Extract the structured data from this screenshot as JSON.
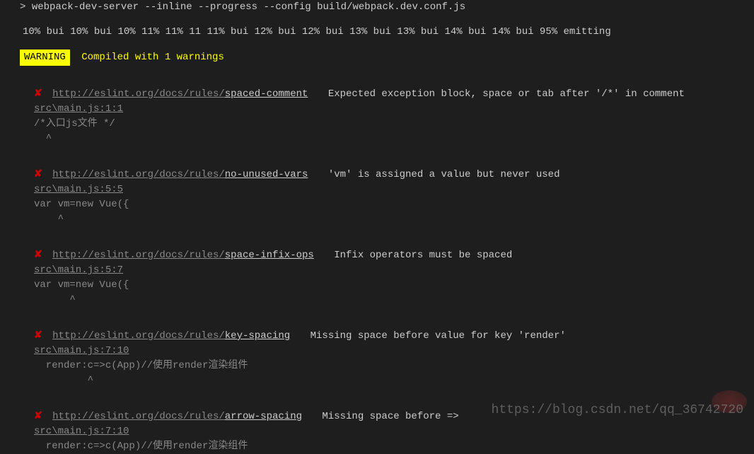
{
  "cmd": {
    "prompt": ">",
    "command": "webpack-dev-server --inline --progress --config build/webpack.dev.conf.js"
  },
  "progress": "10% bui 10% bui 10% 11% 11% 11 11% bui 12% bui 12% bui 13% bui 13% bui 14% bui 14% bui 95% emitting",
  "warning": {
    "badge": "WARNING",
    "text": "Compiled with 1 warnings"
  },
  "errors": [
    {
      "linkBase": "http://eslint.org/docs/rules/",
      "rule": "spaced-comment",
      "message": "Expected exception block, space or tab after '/*' in comment",
      "file": "src\\main.js:1:1",
      "code": "/*入口js文件 */",
      "caret": "  ^"
    },
    {
      "linkBase": "http://eslint.org/docs/rules/",
      "rule": "no-unused-vars",
      "message": "'vm' is assigned a value but never used",
      "file": "src\\main.js:5:5",
      "code": "var vm=new Vue({",
      "caret": "    ^"
    },
    {
      "linkBase": "http://eslint.org/docs/rules/",
      "rule": "space-infix-ops",
      "message": "Infix operators must be spaced",
      "file": "src\\main.js:5:7",
      "code": "var vm=new Vue({",
      "caret": "      ^"
    },
    {
      "linkBase": "http://eslint.org/docs/rules/",
      "rule": "key-spacing",
      "message": "Missing space before value for key 'render'",
      "file": "src\\main.js:7:10",
      "code": "  render:c=>c(App)//使用render渲染组件",
      "caret": "         ^"
    },
    {
      "linkBase": "http://eslint.org/docs/rules/",
      "rule": "arrow-spacing",
      "message": "Missing space before =>",
      "file": "src\\main.js:7:10",
      "code": "  render:c=>c(App)//使用render渲染组件",
      "caret": ""
    }
  ],
  "watermark": "https://blog.csdn.net/qq_36742720"
}
